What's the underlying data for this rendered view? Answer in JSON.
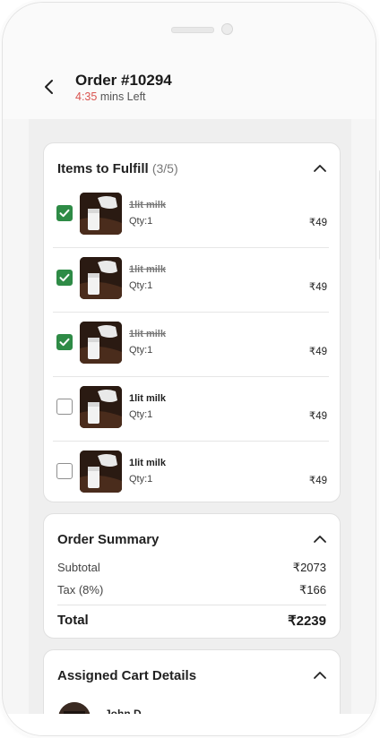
{
  "header": {
    "order_title": "Order #10294",
    "time_left_value": "4:35",
    "time_left_suffix": " mins Left"
  },
  "items_section": {
    "title": "Items to Fulfill",
    "count": "(3/5)",
    "items": [
      {
        "name": "1lit milk",
        "qty": "Qty:1",
        "price": "₹49",
        "checked": true
      },
      {
        "name": "1lit milk",
        "qty": "Qty:1",
        "price": "₹49",
        "checked": true
      },
      {
        "name": "1lit milk",
        "qty": "Qty:1",
        "price": "₹49",
        "checked": true
      },
      {
        "name": "1lit milk",
        "qty": "Qty:1",
        "price": "₹49",
        "checked": false
      },
      {
        "name": "1lit milk",
        "qty": "Qty:1",
        "price": "₹49",
        "checked": false
      }
    ]
  },
  "summary": {
    "title": "Order Summary",
    "subtotal_label": "Subtotal",
    "subtotal_value": "₹2073",
    "tax_label": "Tax (8%)",
    "tax_value": "₹166",
    "total_label": "Total",
    "total_value": "₹2239"
  },
  "cart": {
    "title": "Assigned Cart Details",
    "user_name": "John D."
  },
  "colors": {
    "accent_green": "#2e8b46",
    "timer_red": "#d9534f"
  },
  "icons": [
    "back-arrow-icon",
    "chevron-up-icon",
    "checkbox-checked-icon",
    "checkbox-empty-icon"
  ]
}
